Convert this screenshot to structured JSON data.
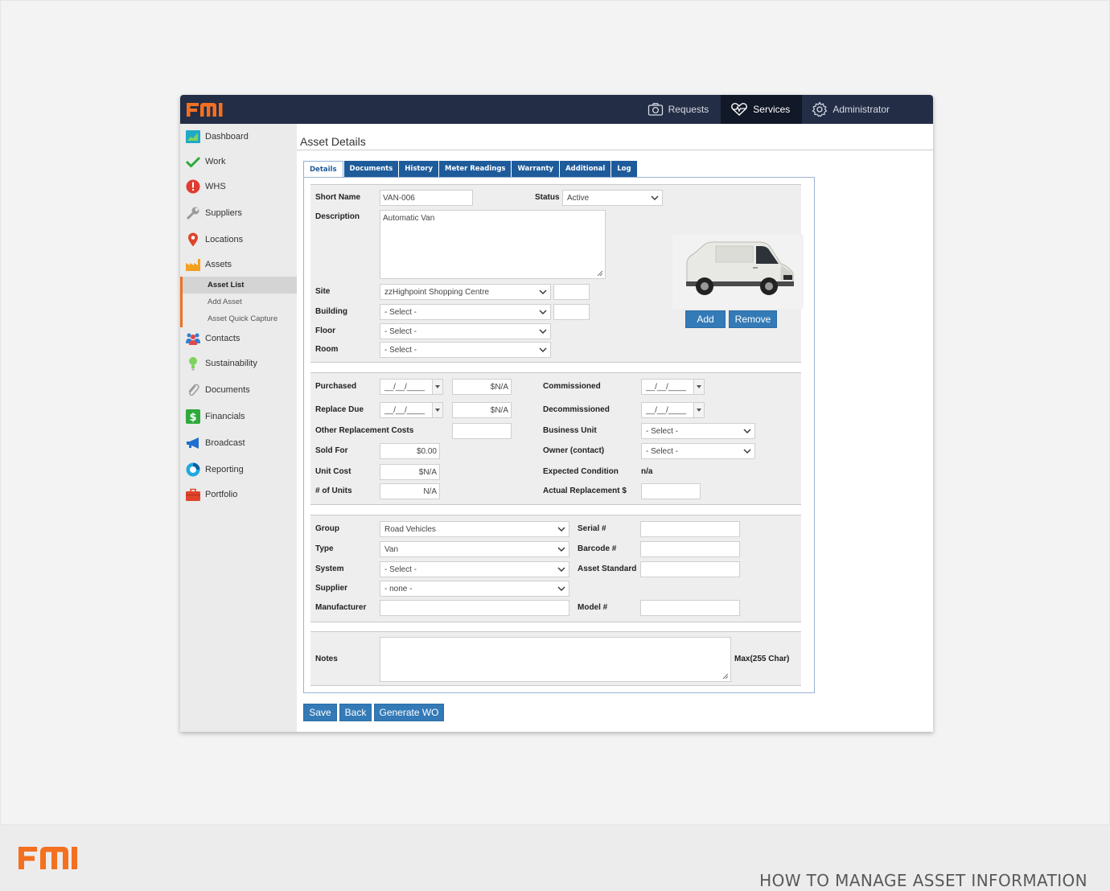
{
  "brand": {
    "logo_text": "FMI",
    "accent": "#f37021",
    "nav_bg": "#232d45",
    "blue": "#337ab7"
  },
  "footer": {
    "caption": "HOW TO MANAGE ASSET INFORMATION"
  },
  "top_nav": [
    {
      "label": "Requests",
      "icon": "camera-icon"
    },
    {
      "label": "Services",
      "icon": "heartbeat-icon",
      "active": true
    },
    {
      "label": "Administrator",
      "icon": "gear-icon"
    }
  ],
  "sidebar": {
    "items": [
      {
        "label": "Dashboard",
        "icon": "dashboard-icon"
      },
      {
        "label": "Work",
        "icon": "checkmark-icon"
      },
      {
        "label": "WHS",
        "icon": "alert-icon"
      },
      {
        "label": "Suppliers",
        "icon": "wrench-icon"
      },
      {
        "label": "Locations",
        "icon": "location-pin-icon"
      },
      {
        "label": "Assets",
        "icon": "factory-icon"
      },
      {
        "label": "Contacts",
        "icon": "people-icon"
      },
      {
        "label": "Sustainability",
        "icon": "lightbulb-icon"
      },
      {
        "label": "Documents",
        "icon": "paperclip-icon"
      },
      {
        "label": "Financials",
        "icon": "dollar-icon"
      },
      {
        "label": "Broadcast",
        "icon": "megaphone-icon"
      },
      {
        "label": "Reporting",
        "icon": "chart-circle-icon"
      },
      {
        "label": "Portfolio",
        "icon": "briefcase-icon"
      }
    ],
    "sub_items": [
      {
        "label": "Asset List",
        "active": true
      },
      {
        "label": "Add Asset"
      },
      {
        "label": "Asset Quick Capture"
      }
    ]
  },
  "page": {
    "title": "Asset Details"
  },
  "tabs": [
    "Details",
    "Documents",
    "History",
    "Meter Readings",
    "Warranty",
    "Additional",
    "Log"
  ],
  "s1": {
    "short_name_label": "Short Name",
    "short_name": "VAN-006",
    "status_label": "Status",
    "status": "Active",
    "description_label": "Description",
    "description": "Automatic Van",
    "site_label": "Site",
    "site": "zzHighpoint Shopping Centre",
    "building_label": "Building",
    "building": "- Select -",
    "floor_label": "Floor",
    "floor": "- Select -",
    "room_label": "Room",
    "room": "- Select -",
    "add_label": "Add",
    "remove_label": "Remove"
  },
  "s2": {
    "purchased_label": "Purchased",
    "purchased_date": "__/__/____",
    "purchased_cost": "$N/A",
    "replace_due_label": "Replace Due",
    "replace_due_date": "__/__/____",
    "replace_due_cost": "$N/A",
    "other_replacement_label": "Other Replacement Costs",
    "sold_for_label": "Sold For",
    "sold_for": "$0.00",
    "unit_cost_label": "Unit Cost",
    "unit_cost": "$N/A",
    "units_label": "# of Units",
    "units": "N/A",
    "commissioned_label": "Commissioned",
    "commissioned": "__/__/____",
    "decommissioned_label": "Decommissioned",
    "decommissioned": "__/__/____",
    "business_unit_label": "Business Unit",
    "business_unit": "- Select -",
    "owner_label": "Owner (contact)",
    "owner": "- Select -",
    "expected_condition_label": "Expected Condition",
    "expected_condition": "n/a",
    "actual_replacement_label": "Actual Replacement $"
  },
  "s3": {
    "group_label": "Group",
    "group": "Road Vehicles",
    "type_label": "Type",
    "type": "Van",
    "system_label": "System",
    "system": "- Select -",
    "supplier_label": "Supplier",
    "supplier": "- none -",
    "manufacturer_label": "Manufacturer",
    "serial_label": "Serial #",
    "barcode_label": "Barcode #",
    "asset_standard_label": "Asset Standard",
    "model_label": "Model #"
  },
  "s4": {
    "notes_label": "Notes",
    "max_label": "Max(255 Char)"
  },
  "actions": {
    "save": "Save",
    "back": "Back",
    "generate_wo": "Generate WO"
  }
}
